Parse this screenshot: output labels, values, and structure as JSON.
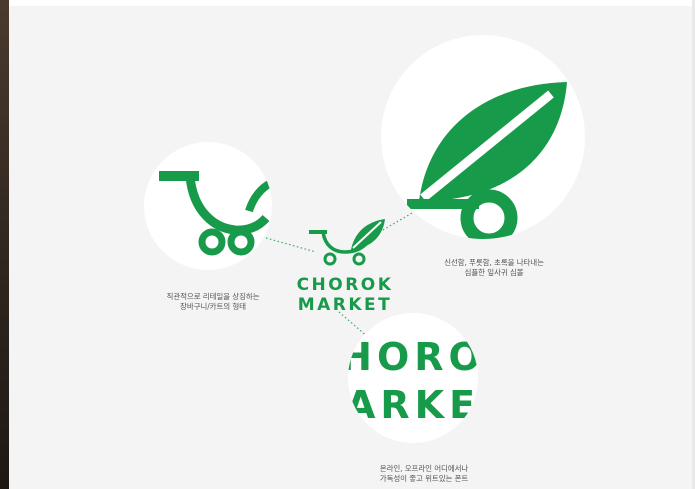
{
  "logo": {
    "line1": "CHOROK",
    "line2": "MARKET",
    "brand_color": "#179a4a",
    "icon": "leaf-cart-icon"
  },
  "zoom_bottom": {
    "line1": "HORO",
    "line2": "ARKE"
  },
  "captions": {
    "cart": [
      "직관적으로 리테일을 상징하는",
      "장바구니/카트의 형태"
    ],
    "leaf": [
      "신선함, 푸릇함, 초록을 나타내는",
      "심플한 잎사귀 심볼"
    ],
    "font": [
      "온라인, 오프라인 어디에서나",
      "가독성이 좋고 위트있는 폰트"
    ]
  },
  "colors": {
    "background": "#f4f4f4",
    "circle": "#ffffff",
    "connector": "#3aa866",
    "caption_text": "#555555"
  }
}
